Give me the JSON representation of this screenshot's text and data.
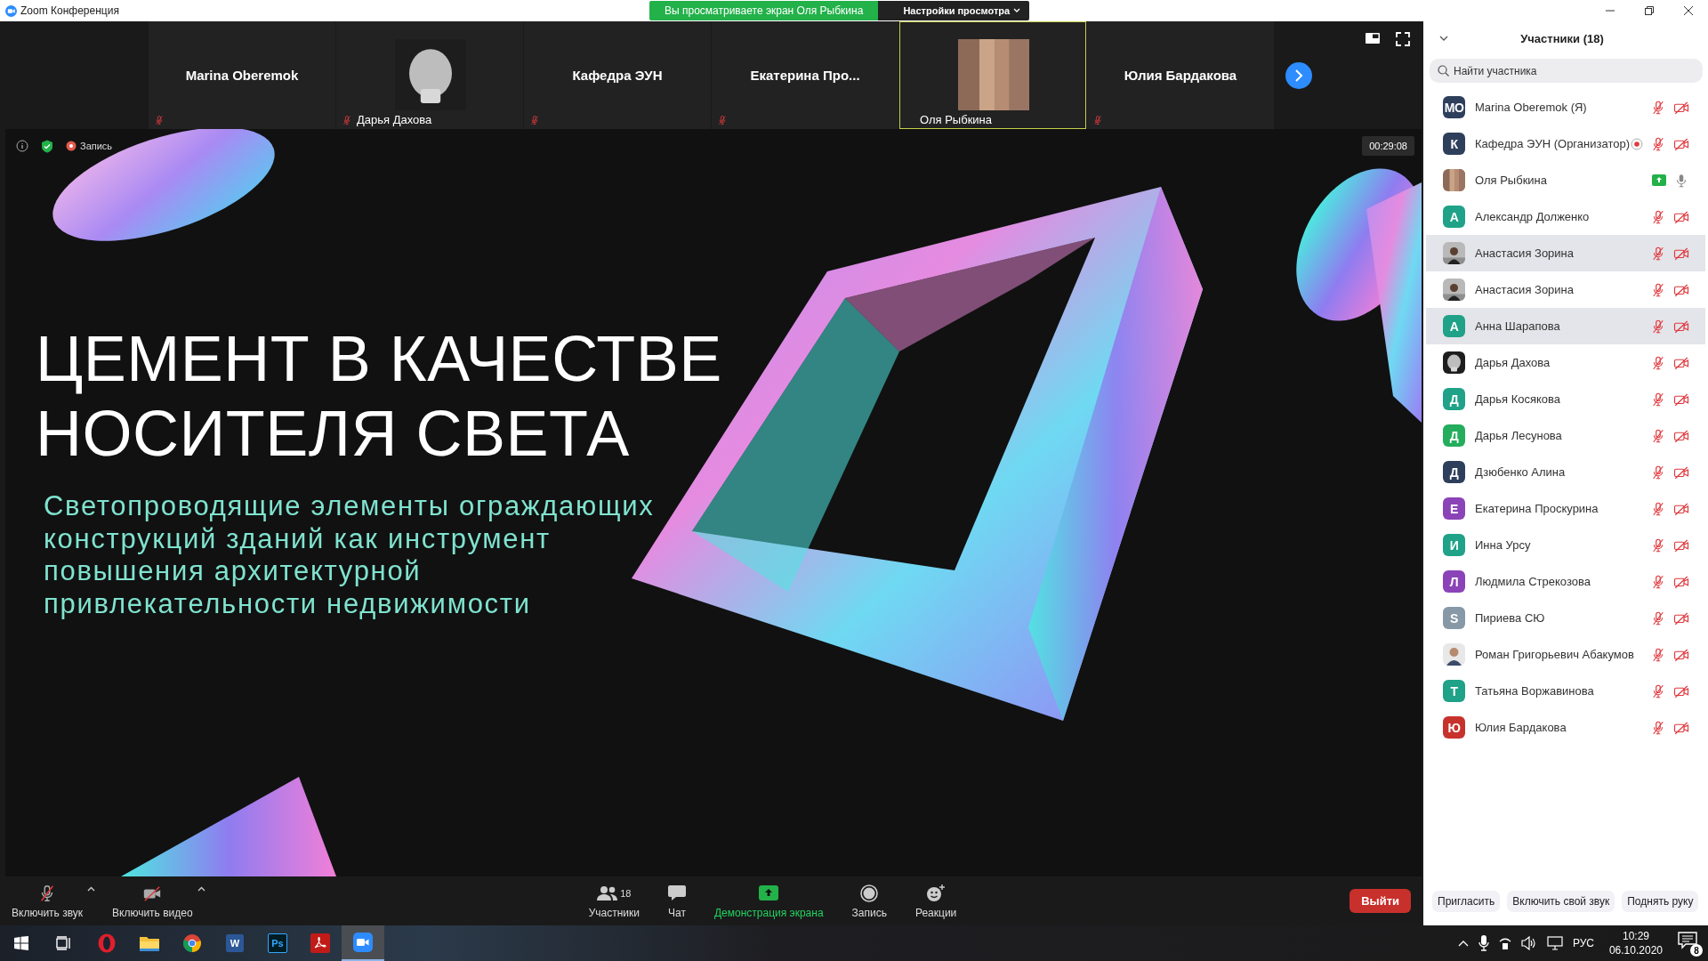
{
  "window": {
    "title": "Zoom Конференция",
    "share_banner": "Вы просматриваете экран Оля Рыбкина",
    "view_options": "Настройки просмотра"
  },
  "video_strip": {
    "tiles": [
      {
        "kind": "name",
        "name": "Marina Oberemok",
        "muted": true,
        "active": false
      },
      {
        "kind": "picture",
        "name": "Дарья Дахова",
        "muted": true,
        "active": false
      },
      {
        "kind": "name",
        "name": "Кафедра ЭУН",
        "muted": true,
        "active": false
      },
      {
        "kind": "name",
        "name": "Екатерина  Про...",
        "muted": true,
        "active": false
      },
      {
        "kind": "picture",
        "name": "Оля Рыбкина",
        "muted": false,
        "active": true
      },
      {
        "kind": "name",
        "name": "Юлия Бардакова",
        "muted": true,
        "active": false
      }
    ]
  },
  "slide": {
    "recording_label": "Запись",
    "timer": "00:29:08",
    "title_lines": [
      "ЦЕМЕНТ В КАЧЕСТВЕ",
      "НОСИТЕЛЯ СВЕТА"
    ],
    "subtitle_lines": [
      "Светопроводящие элементы ограждающих",
      "конструкций зданий как инструмент",
      "повышения архитектурной",
      "привлекательности недвижимости"
    ]
  },
  "toolbar": {
    "left": [
      {
        "kind": "mic",
        "label": "Включить звук"
      },
      {
        "kind": "video",
        "label": "Включить видео"
      }
    ],
    "center": [
      {
        "kind": "participants",
        "label": "Участники",
        "count": "18"
      },
      {
        "kind": "chat",
        "label": "Чат"
      },
      {
        "kind": "share",
        "label": "Демонстрация экрана"
      },
      {
        "kind": "record",
        "label": "Запись"
      },
      {
        "kind": "reactions",
        "label": "Реакции"
      }
    ],
    "leave": "Выйти"
  },
  "participants": {
    "title": "Участники (18)",
    "search": {
      "placeholder": "Найти участника"
    },
    "list": [
      {
        "name": "Marina Oberemok (Я)",
        "avatar": {
          "kind": "initials",
          "text": "MO",
          "color": "#2e3f5c"
        },
        "recording": false,
        "sharing": false,
        "muted": true,
        "video_off": true,
        "highlighted": false
      },
      {
        "name": "Кафедра ЭУН (Организатор)",
        "avatar": {
          "kind": "initials",
          "text": "К",
          "color": "#2e3f5c"
        },
        "recording": true,
        "sharing": false,
        "muted": true,
        "video_off": true,
        "highlighted": false
      },
      {
        "name": "Оля Рыбкина",
        "recording": false,
        "sharing": true,
        "muted": false,
        "video_off": false,
        "highlighted": false
      },
      {
        "name": "Александр Долженко",
        "avatar": {
          "kind": "initials",
          "text": "А",
          "color": "#1fa287"
        },
        "recording": false,
        "sharing": false,
        "muted": true,
        "video_off": true,
        "highlighted": false
      },
      {
        "name": "Анастасия Зорина",
        "recording": false,
        "sharing": false,
        "muted": true,
        "video_off": true,
        "highlighted": true
      },
      {
        "name": "Анастасия Зорина",
        "recording": false,
        "sharing": false,
        "muted": true,
        "video_off": true,
        "highlighted": false
      },
      {
        "name": "Анна Шарапова",
        "avatar": {
          "kind": "initials",
          "text": "А",
          "color": "#1fa287"
        },
        "recording": false,
        "sharing": false,
        "muted": true,
        "video_off": true,
        "highlighted": true
      },
      {
        "name": "Дарья Дахова",
        "recording": false,
        "sharing": false,
        "muted": true,
        "video_off": true,
        "highlighted": false
      },
      {
        "name": "Дарья Косякова",
        "avatar": {
          "kind": "initials",
          "text": "Д",
          "color": "#1fa287"
        },
        "recording": false,
        "sharing": false,
        "muted": true,
        "video_off": true,
        "highlighted": false
      },
      {
        "name": "Дарья Лесунова",
        "avatar": {
          "kind": "initials",
          "text": "Д",
          "color": "#23ad5c"
        },
        "recording": false,
        "sharing": false,
        "muted": true,
        "video_off": true,
        "highlighted": false
      },
      {
        "name": "Дзюбенко Алина",
        "avatar": {
          "kind": "initials",
          "text": "Д",
          "color": "#2e3f5c"
        },
        "recording": false,
        "sharing": false,
        "muted": true,
        "video_off": true,
        "highlighted": false
      },
      {
        "name": "Екатерина Проскурина",
        "avatar": {
          "kind": "initials",
          "text": "Е",
          "color": "#8a44b8"
        },
        "recording": false,
        "sharing": false,
        "muted": true,
        "video_off": true,
        "highlighted": false
      },
      {
        "name": "Инна Урсу",
        "avatar": {
          "kind": "initials",
          "text": "И",
          "color": "#1fa287"
        },
        "recording": false,
        "sharing": false,
        "muted": true,
        "video_off": true,
        "highlighted": false
      },
      {
        "name": "Людмила Стрекозова",
        "avatar": {
          "kind": "initials",
          "text": "Л",
          "color": "#8a44b8"
        },
        "recording": false,
        "sharing": false,
        "muted": true,
        "video_off": true,
        "highlighted": false
      },
      {
        "name": "Пириева СЮ",
        "avatar": {
          "kind": "initials",
          "text": "S",
          "color": "#8798a6"
        },
        "recording": false,
        "sharing": false,
        "muted": true,
        "video_off": true,
        "highlighted": false
      },
      {
        "name": "Роман Григорьевич Абакумов",
        "recording": false,
        "sharing": false,
        "muted": true,
        "video_off": true,
        "highlighted": false
      },
      {
        "name": "Татьяна Воржавинова",
        "avatar": {
          "kind": "initials",
          "text": "Т",
          "color": "#1fa287"
        },
        "recording": false,
        "sharing": false,
        "muted": true,
        "video_off": true,
        "highlighted": false
      },
      {
        "name": "Юлия Бардакова",
        "avatar": {
          "kind": "initials",
          "text": "Ю",
          "color": "#c8322c"
        },
        "recording": false,
        "sharing": false,
        "muted": true,
        "video_off": true,
        "highlighted": false
      }
    ],
    "buttons": [
      "Пригласить",
      "Включить свой звук",
      "Поднять руку"
    ]
  },
  "taskbar": {
    "apps": [
      {
        "kind": "start",
        "selected": false
      },
      {
        "kind": "task-view",
        "selected": false
      },
      {
        "kind": "opera",
        "selected": false
      },
      {
        "kind": "explorer",
        "selected": false
      },
      {
        "kind": "chrome",
        "selected": false
      },
      {
        "kind": "word",
        "label": "W",
        "selected": false
      },
      {
        "kind": "photoshop",
        "label": "Ps",
        "selected": false
      },
      {
        "kind": "acrobat",
        "selected": false
      },
      {
        "kind": "zoom",
        "selected": true
      }
    ],
    "language": "РУС",
    "time": "10:29",
    "date": "06.10.2020",
    "notifications": "8"
  }
}
